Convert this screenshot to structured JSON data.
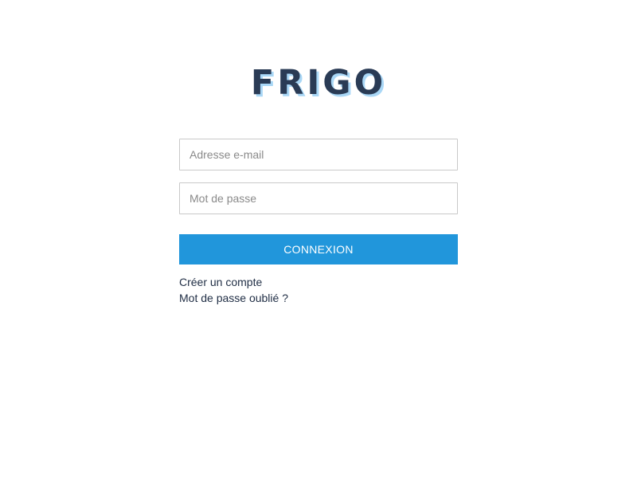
{
  "header": {
    "logo_text": "FRIGO"
  },
  "login_form": {
    "email_placeholder": "Adresse e-mail",
    "password_placeholder": "Mot de passe",
    "submit_label": "CONNEXION"
  },
  "links": {
    "create_account": "Créer un compte",
    "forgot_password": "Mot de passe oublié ?"
  },
  "colors": {
    "logo_text": "#2a3b55",
    "logo_shadow": "#a9d7f6",
    "button": "#2196db",
    "link": "#1f2d44"
  }
}
